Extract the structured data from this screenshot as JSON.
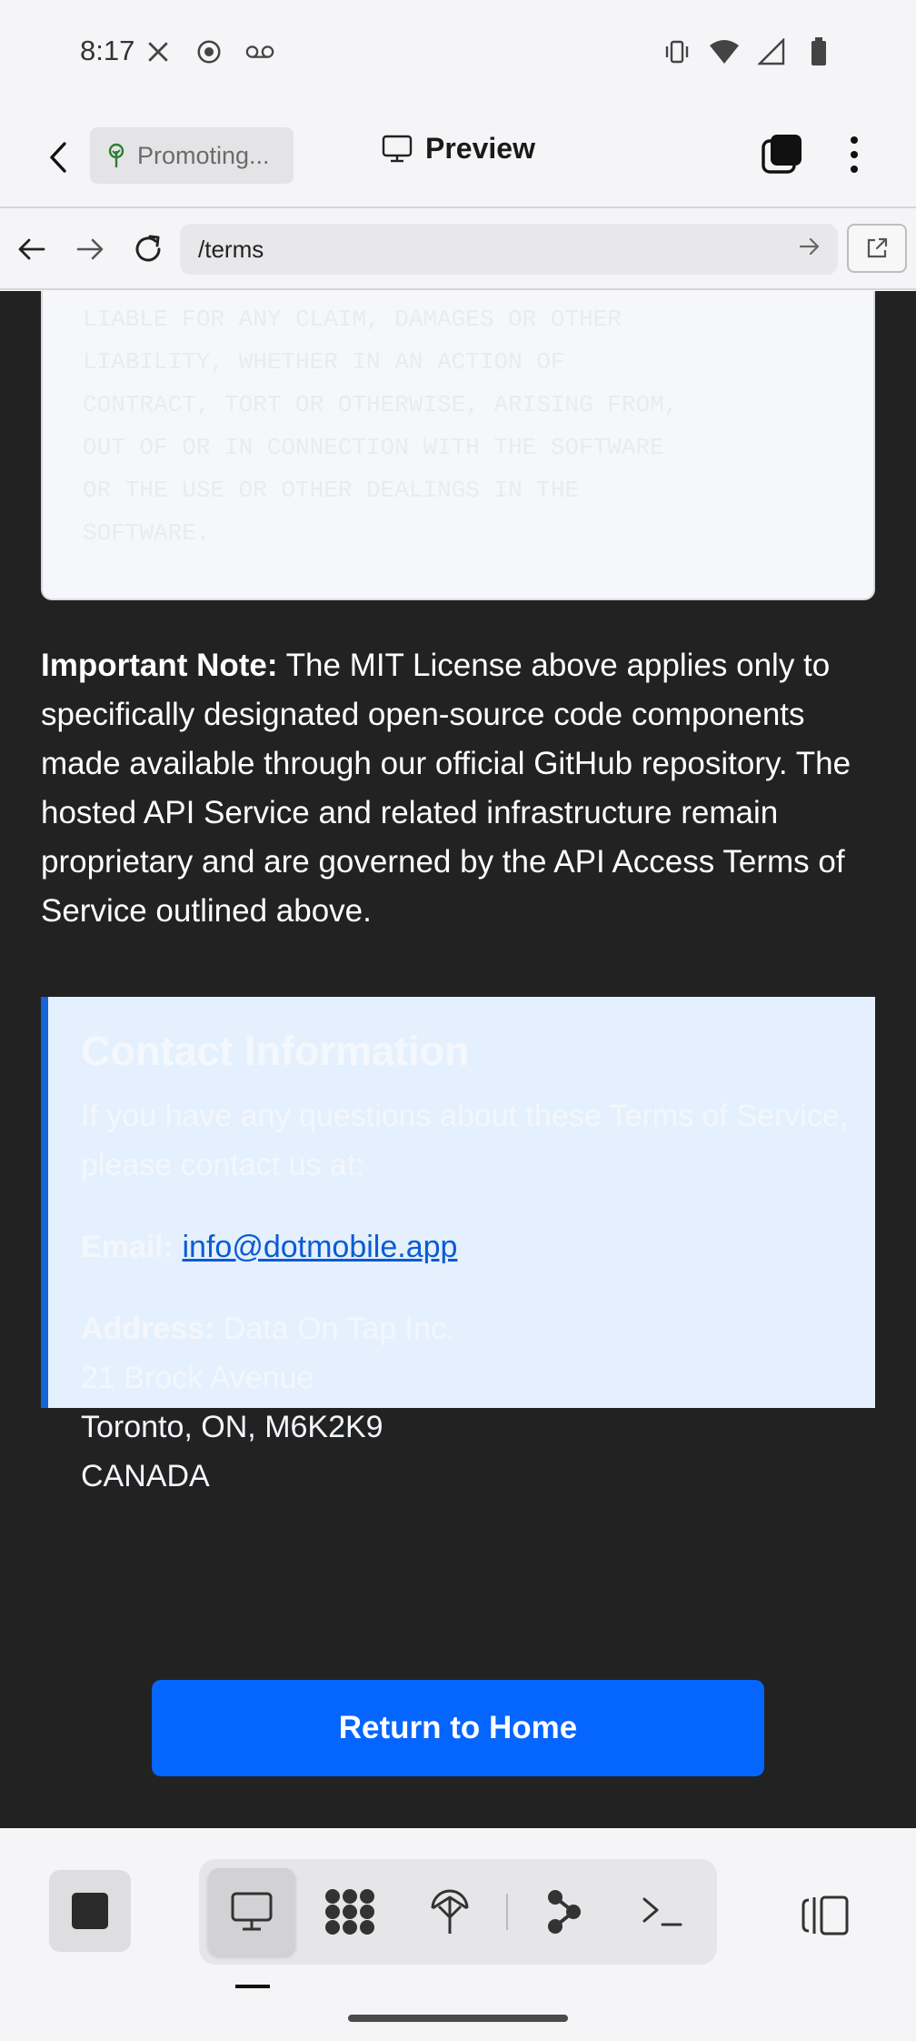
{
  "status_bar": {
    "time": "8:17",
    "left_icons": [
      "x-logo-icon",
      "record-icon",
      "voicemail-icon"
    ],
    "right_icons": [
      "vibrate-icon",
      "wifi-icon",
      "signal-icon",
      "battery-icon"
    ]
  },
  "header": {
    "project_label": "Promoting...",
    "title": "Preview"
  },
  "url_bar": {
    "path": "/terms"
  },
  "page": {
    "license_excerpt": "LIABLE FOR ANY CLAIM, DAMAGES OR OTHER\nLIABILITY, WHETHER IN AN ACTION OF\nCONTRACT, TORT OR OTHERWISE, ARISING FROM,\nOUT OF OR IN CONNECTION WITH THE SOFTWARE\nOR THE USE OR OTHER DEALINGS IN THE\nSOFTWARE.",
    "note_label": "Important Note:",
    "note_text": " The MIT License above applies only to specifically designated open-source code components made available through our official GitHub repository. The hosted API Service and related infrastructure remain proprietary and are governed by the API Access Terms of Service outlined above.",
    "contact": {
      "title": "Contact Information",
      "intro": "If you have any questions about these Terms of Service, please contact us at:",
      "email_label": "Email:",
      "email": "info@dotmobile.app",
      "address_label": "Address:",
      "address_lines": [
        "Data On Tap Inc.",
        "21 Brock Avenue",
        "Toronto, ON, M6K2K9",
        "CANADA"
      ]
    },
    "home_button": "Return to Home"
  },
  "colors": {
    "accent": "#0565ff",
    "content_background": "#222223",
    "contact_border": "#1565d8",
    "contact_background": "#e4f0fd"
  }
}
